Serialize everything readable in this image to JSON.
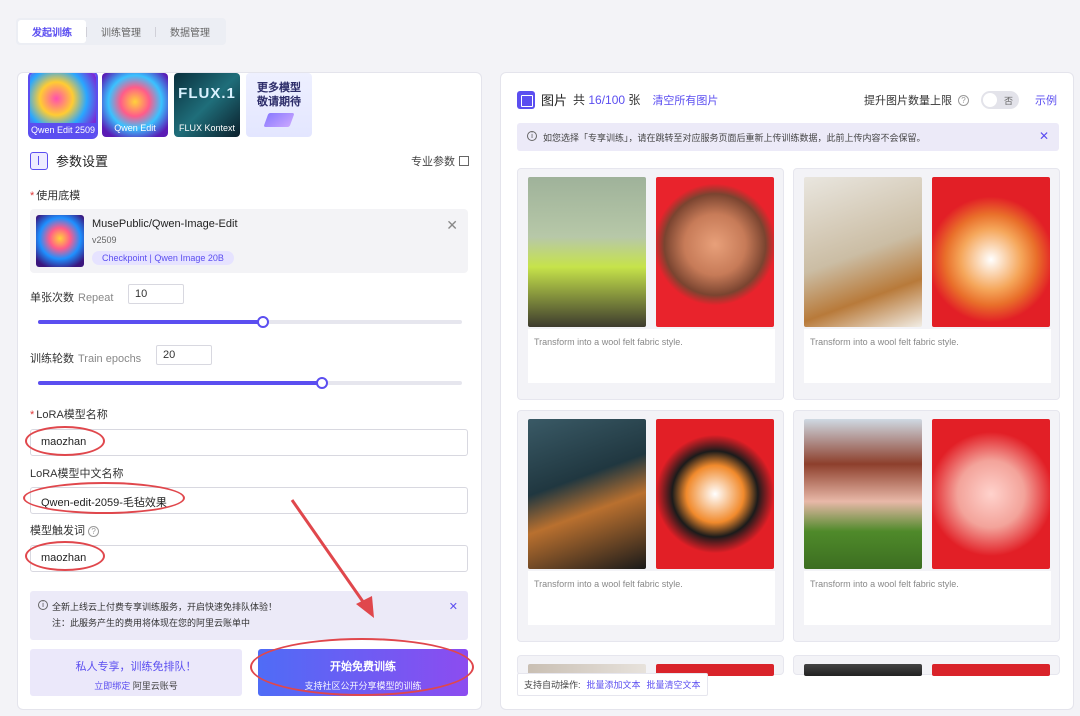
{
  "tabs": [
    "发起训练",
    "训练管理",
    "数据管理"
  ],
  "models": [
    {
      "label": "Qwen Edit 2509",
      "selected": true
    },
    {
      "label": "Qwen Edit",
      "selected": false
    },
    {
      "label": "FLUX Kontext",
      "logo": "FLUX.1",
      "selected": false
    },
    {
      "label": "更多模型\n敬请期待",
      "selected": false
    }
  ],
  "params": {
    "title": "参数设置",
    "pro_label": "专业参数",
    "base_model_label": "使用底模",
    "base_model": {
      "name": "MusePublic/Qwen-Image-Edit",
      "version": "v2509",
      "tag": "Checkpoint | Qwen Image 20B"
    },
    "repeat_label": "单张次数",
    "repeat_hint": "Repeat",
    "repeat_value": "10",
    "repeat_fraction": 0.53,
    "epochs_label": "训练轮数",
    "epochs_hint": "Train epochs",
    "epochs_value": "20",
    "epochs_fraction": 0.67,
    "lora_name_label": "LoRA模型名称",
    "lora_name": "maozhan",
    "lora_cn_label": "LoRA模型中文名称",
    "lora_cn": "Qwen-edit-2059-毛毡效果",
    "trigger_label": "模型触发词",
    "trigger": "maozhan"
  },
  "notice": {
    "line1": "全新上线云上付费专享训练服务，开启快速免排队体验！",
    "line2": "注：此服务产生的费用将体现在您的阿里云账单中"
  },
  "private_btn": {
    "title": "私人专享，训练免排队！",
    "sub_link": "立即绑定",
    "sub_rest": "阿里云账号"
  },
  "start_btn": {
    "title": "开始免费训练",
    "sub": "支持社区公开分享模型的训练"
  },
  "images": {
    "title": "图片",
    "count_prefix": "共",
    "count_value": "16/100",
    "count_suffix": "张",
    "clear": "清空所有图片",
    "raise_label": "提升图片数量上限",
    "toggle_text": "否",
    "example": "示例",
    "notice": "如您选择「专享训练」，请在跳转至对应服务页面后重新上传训练数据，此前上传内容不会保留。",
    "caption": "Transform into a wool felt fabric style."
  },
  "footer": {
    "label": "支持自动操作:",
    "batch_add": "批量添加文本",
    "batch_clear": "批量清空文本"
  },
  "colors": {
    "accent": "#5b4ef0",
    "annotation": "#e0474c"
  }
}
